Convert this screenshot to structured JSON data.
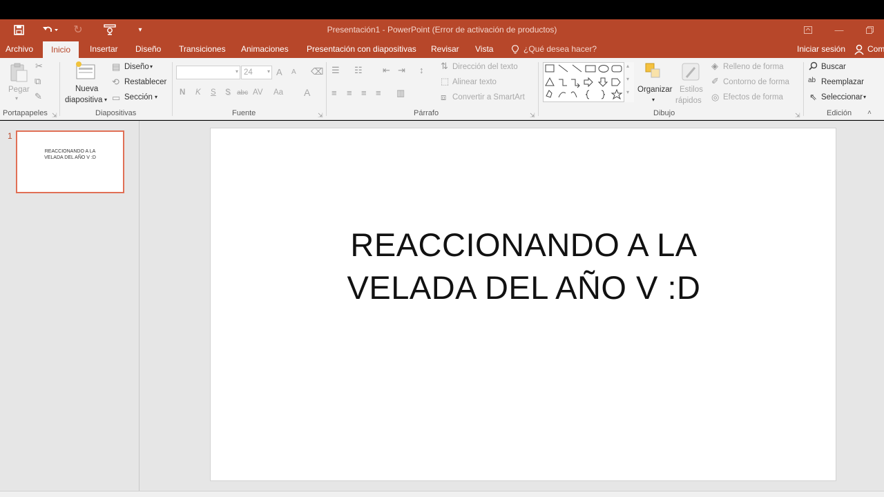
{
  "window": {
    "title": "Presentación1 - PowerPoint (Error de activación de productos)"
  },
  "tabs": {
    "archivo": "Archivo",
    "inicio": "Inicio",
    "insertar": "Insertar",
    "diseno": "Diseño",
    "transiciones": "Transiciones",
    "animaciones": "Animaciones",
    "presentacion": "Presentación con diapositivas",
    "revisar": "Revisar",
    "vista": "Vista",
    "tell_me": "¿Qué desea hacer?",
    "signin": "Iniciar sesión",
    "share": "Com"
  },
  "ribbon": {
    "clipboard": {
      "paste": "Pegar",
      "label": "Portapapeles"
    },
    "slides": {
      "new_slide_1": "Nueva",
      "new_slide_2": "diapositiva",
      "layout": "Diseño",
      "reset": "Restablecer",
      "section": "Sección",
      "label": "Diapositivas"
    },
    "font": {
      "font_name": "",
      "font_size": "24",
      "bold": "N",
      "italic": "K",
      "underline": "S",
      "shadow": "S",
      "strike": "abc",
      "spacing": "AV",
      "case": "Aa",
      "color": "A",
      "grow": "A",
      "shrink": "A",
      "label": "Fuente"
    },
    "paragraph": {
      "text_direction": "Dirección del texto",
      "align_text": "Alinear texto",
      "smartart": "Convertir a SmartArt",
      "label": "Párrafo"
    },
    "drawing": {
      "arrange": "Organizar",
      "quick_styles_1": "Estilos",
      "quick_styles_2": "rápidos",
      "shape_fill": "Relleno de forma",
      "shape_outline": "Contorno de forma",
      "shape_effects": "Efectos de forma",
      "label": "Dibujo"
    },
    "editing": {
      "find": "Buscar",
      "replace": "Reemplazar",
      "select": "Seleccionar",
      "label": "Edición"
    }
  },
  "thumbnails": [
    {
      "number": "1",
      "title_line1": "REACCIONANDO A LA",
      "title_line2": "VELADA DEL AÑO V :D"
    }
  ],
  "slide": {
    "title_line1": "REACCIONANDO A LA",
    "title_line2": "VELADA DEL AÑO V :D"
  },
  "colors": {
    "accent": "#b7472a",
    "ribbon": "#f3f3f3",
    "workspace": "#e6e6e6"
  }
}
